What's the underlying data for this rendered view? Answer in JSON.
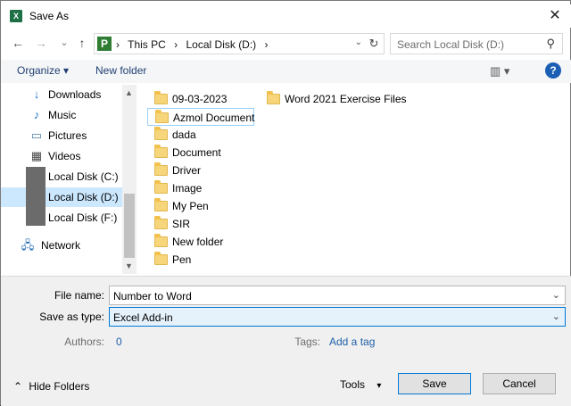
{
  "window": {
    "title": "Save As",
    "app_icon_letter": "X",
    "close_glyph": "✕"
  },
  "nav": {
    "back_glyph": "←",
    "forward_glyph": "→",
    "recent_glyph": "⌄",
    "up_glyph": "↑",
    "address_logo_letter": "P",
    "breadcrumbs": [
      "›",
      "This PC",
      "›",
      "Local Disk (D:)",
      "›"
    ],
    "refresh_glyph": "↻",
    "dropdown_glyph": "⌄",
    "search_placeholder": "Search Local Disk (D:)",
    "search_glyph": "⚲"
  },
  "toolbar": {
    "organize_label": "Organize ▾",
    "new_folder_label": "New folder",
    "view_glyph": "▥ ▾",
    "help_glyph": "?"
  },
  "sidebar": {
    "items": [
      {
        "label": "Downloads",
        "icon": "↓",
        "icon_name": "downloads-icon"
      },
      {
        "label": "Music",
        "icon": "♪",
        "icon_name": "music-icon"
      },
      {
        "label": "Pictures",
        "icon": "▭",
        "icon_name": "pictures-icon"
      },
      {
        "label": "Videos",
        "icon": "▦",
        "icon_name": "videos-icon"
      },
      {
        "label": "Local Disk (C:)",
        "icon": "",
        "icon_name": "drive-icon"
      },
      {
        "label": "Local Disk (D:)",
        "icon": "",
        "icon_name": "drive-icon",
        "selected": true
      },
      {
        "label": "Local Disk (F:)",
        "icon": "",
        "icon_name": "drive-icon"
      },
      {
        "label": "Network",
        "icon": "🖧",
        "icon_name": "network-icon"
      }
    ]
  },
  "files": {
    "col1": [
      "09-03-2023",
      "Azmol Document",
      "dada",
      "Document",
      "Driver",
      "Image",
      "My Pen",
      "SIR",
      "New folder",
      "Pen"
    ],
    "col2": [
      "Word 2021 Exercise Files"
    ]
  },
  "form": {
    "file_name_label": "File name:",
    "file_name_value": "Number to Word",
    "save_type_label": "Save as type:",
    "save_type_value": "Excel Add-in",
    "authors_label": "Authors:",
    "authors_value": "0",
    "tags_label": "Tags:",
    "tags_value": "Add a tag"
  },
  "footer": {
    "hide_folders_label": "Hide Folders",
    "hide_glyph": "⌃",
    "tools_label": "Tools",
    "tools_glyph": "▾",
    "save_label": "Save",
    "cancel_label": "Cancel"
  },
  "colors": {
    "selection": "#cce8ff",
    "accent": "#0078d7",
    "link": "#1f5fa8"
  }
}
